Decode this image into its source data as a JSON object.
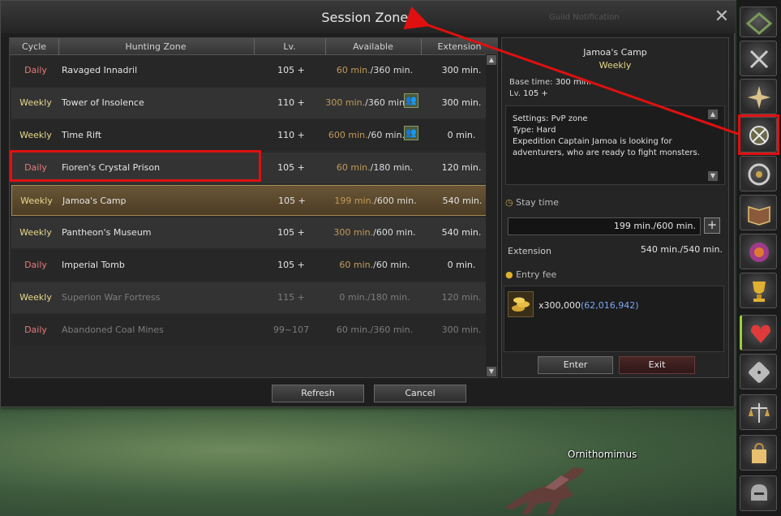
{
  "window": {
    "title": "Session Zones",
    "ghost_title": "Guild Notification",
    "close_symbol": "✕"
  },
  "table": {
    "headers": [
      "Cycle",
      "Hunting Zone",
      "Lv.",
      "Available",
      "Extension"
    ],
    "rows": [
      {
        "cycle": "Daily",
        "zone": "Ravaged Innadril",
        "lv": "105  +",
        "used": "60 min.",
        "total": "/360 min.",
        "ext": "300 min."
      },
      {
        "cycle": "Weekly",
        "zone": "Tower of Insolence",
        "lv": "110  +",
        "used": "300 min.",
        "total": "/360 min.",
        "ext": "300 min."
      },
      {
        "cycle": "Weekly",
        "zone": "Time Rift",
        "lv": "110  +",
        "used": "600 min.",
        "total": "/60 min.",
        "ext": "0 min."
      },
      {
        "cycle": "Daily",
        "zone": "Fioren's Crystal Prison",
        "lv": "105  +",
        "used": "60 min.",
        "total": "/180 min.",
        "ext": "120 min."
      },
      {
        "cycle": "Weekly",
        "zone": "Jamoa's Camp",
        "lv": "105  +",
        "used": "199 min.",
        "total": "/600 min.",
        "ext": "540 min."
      },
      {
        "cycle": "Weekly",
        "zone": "Pantheon's Museum",
        "lv": "105  +",
        "used": "300 min.",
        "total": "/600 min.",
        "ext": "540 min."
      },
      {
        "cycle": "Daily",
        "zone": "Imperial Tomb",
        "lv": "105  +",
        "used": "60 min.",
        "total": "/60 min.",
        "ext": "0 min."
      },
      {
        "cycle": "Weekly",
        "zone": "Superion War Fortress",
        "lv": "115  +",
        "used": "0 min.",
        "total": "/180 min.",
        "ext": "120 min."
      },
      {
        "cycle": "Daily",
        "zone": "Abandoned Coal Mines",
        "lv": "99~107",
        "used": "60 min.",
        "total": "/360 min.",
        "ext": "300 min."
      }
    ]
  },
  "buttons": {
    "refresh": "Refresh",
    "cancel": "Cancel",
    "enter": "Enter",
    "exit": "Exit"
  },
  "details": {
    "zone_name": "Jamoa's Camp",
    "cycle": "Weekly",
    "base_time_label": "Base time:",
    "base_time": "300 min.",
    "lv_label": "Lv.",
    "lv": "105  +",
    "desc": [
      "Settings: PvP zone",
      "Type: Hard",
      "Expedition Captain Jamoa is looking for",
      " adventurers, who are ready to fight monsters."
    ],
    "stay_label": "Stay time",
    "stay_value": "199 min./600 min.",
    "extension_label": "Extension",
    "extension_value": "540 min./540 min.",
    "entry_fee_label": "Entry fee",
    "fee_amount": "x300,000",
    "fee_balance": "(62,016,942)"
  },
  "world": {
    "creature_name": "Ornithomimus"
  },
  "colors": {
    "daily": "#e77a7a",
    "weekly": "#e6d88a",
    "highlight": "#e01010",
    "balance": "#7fa6f5"
  }
}
